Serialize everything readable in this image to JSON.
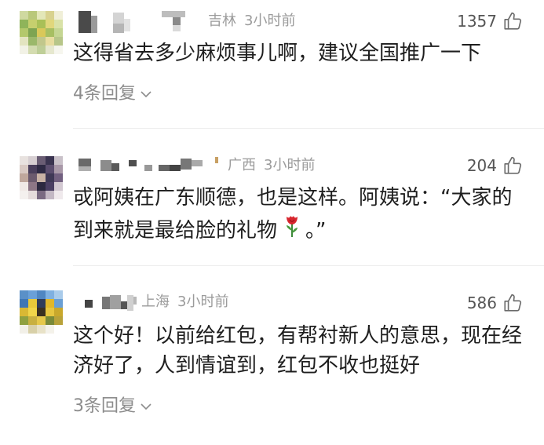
{
  "colors": {
    "background": "#ffffff",
    "text": "#1e1e1e",
    "meta": "#9b9b9b",
    "reply": "#8c8c8c",
    "like_count": "#555555",
    "icon": "#6b6b6b",
    "divider": "#ededed"
  },
  "icons": {
    "like": "thumbs-up-icon",
    "expand_replies": "chevron-down-icon",
    "emoji": "rose-emoji-icon",
    "avatar": "pixelated-avatar",
    "username": "pixelated-username"
  },
  "comments": [
    {
      "location": "吉林",
      "time": "3小时前",
      "likes": "1357",
      "lines": [
        "这得省去多少麻烦事儿啊，建议全国推广一下"
      ],
      "replies": "4条回复"
    },
    {
      "location": "广西",
      "time": "3小时前",
      "likes": "204",
      "lines": [
        "戓阿姨在广东顺德，也是这样。阿姨说：“大家的",
        "到来就是最给脸的礼物"
      ],
      "line_end": "。”"
    },
    {
      "location": "上海",
      "time": "3小时前",
      "likes": "586",
      "lines": [
        "这个好！以前给红包，有帮衬新人的意思，现在经",
        "济好了，人到情谊到，红包不收也挺好"
      ],
      "replies": "3条回复"
    }
  ]
}
